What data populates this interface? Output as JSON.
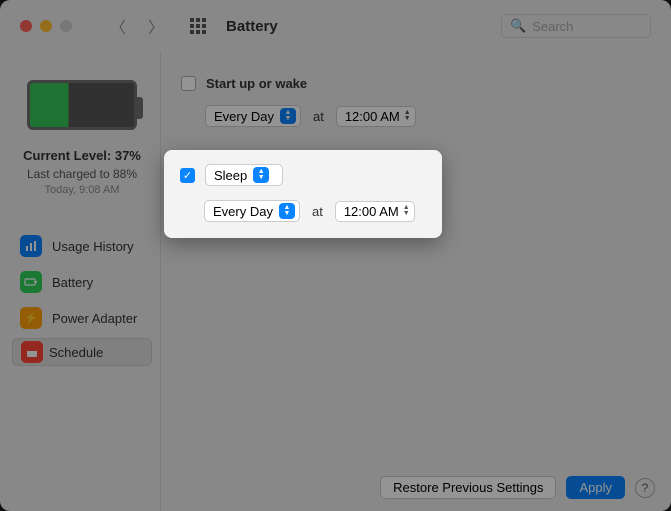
{
  "titlebar": {
    "title": "Battery",
    "search_placeholder": "Search"
  },
  "sidebar": {
    "level_label": "Current Level: 37%",
    "charged_label": "Last charged to 88%",
    "time_label": "Today, 9:08 AM",
    "items": [
      {
        "label": "Usage History"
      },
      {
        "label": "Battery"
      },
      {
        "label": "Power Adapter"
      },
      {
        "label": "Schedule"
      }
    ]
  },
  "schedule": {
    "startup_label": "Start up or wake",
    "day_options_selected": "Every Day",
    "at_label": "at",
    "time_value": "12:00 AM",
    "sleep_label": "Sleep",
    "sleep_day": "Every Day",
    "sleep_time": "12:00 AM"
  },
  "footer": {
    "restore": "Restore Previous Settings",
    "apply": "Apply",
    "help": "?"
  }
}
